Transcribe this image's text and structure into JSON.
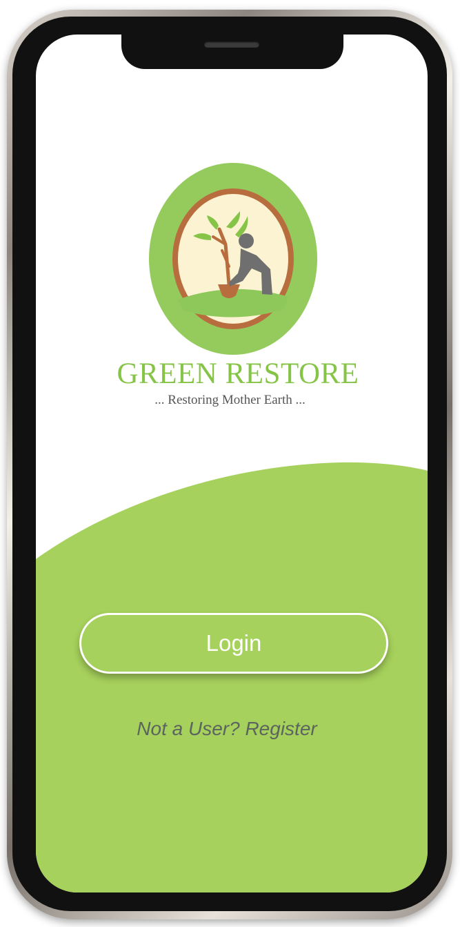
{
  "app": {
    "brand_name": "GREEN RESTORE",
    "tagline": "... Restoring Mother Earth ..."
  },
  "actions": {
    "login_label": "Login",
    "register_label": "Not a User? Register"
  },
  "logo": {
    "icon": "planting-tree-icon"
  },
  "colors": {
    "brand_green": "#a6d15c",
    "logo_green": "#95cb5d",
    "title_green": "#85c447",
    "ring_brown": "#b86d3e",
    "inner_cream": "#fbf3d2"
  }
}
